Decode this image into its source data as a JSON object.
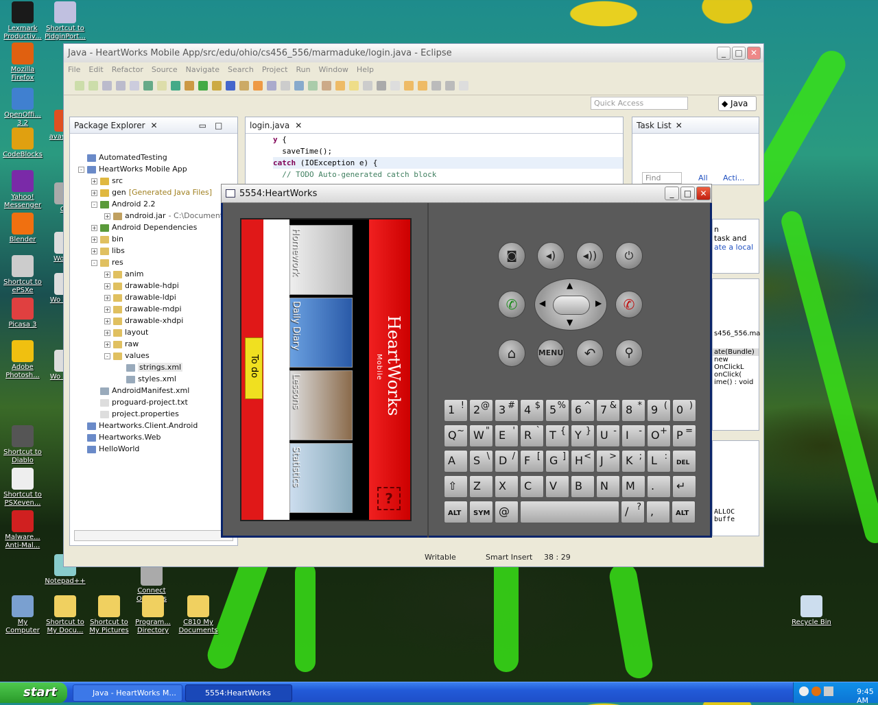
{
  "desktop": {
    "icons": [
      {
        "label": "Lexmark Productiv...",
        "color": "#1a1a1a"
      },
      {
        "label": "Shortcut to PidginPort...",
        "color": "#c0c0e0"
      },
      {
        "label": "Mozilla Firefox",
        "color": "#e06010"
      },
      {
        "label": "OpenOffi... 3.2",
        "color": "#4080d0"
      },
      {
        "label": "avas Anti",
        "color": "#e05020"
      },
      {
        "label": "CodeBlocks",
        "color": "#e0a010"
      },
      {
        "label": "Yahoo! Messenger",
        "color": "#7a2aa8"
      },
      {
        "label": "Git",
        "color": "#aaa"
      },
      {
        "label": "Blender",
        "color": "#f07010"
      },
      {
        "label": "Wo Wa",
        "color": "#ddd"
      },
      {
        "label": "Shortcut to ePSXe",
        "color": "#ccc"
      },
      {
        "label": "Wo Ward",
        "color": "#ddd"
      },
      {
        "label": "Picasa 3",
        "color": "#e04040"
      },
      {
        "label": "Adobe Photosh...",
        "color": "#f0c010"
      },
      {
        "label": "Wo Ward",
        "color": "#ddd"
      },
      {
        "label": "Shortcut to Diablo",
        "color": "#555"
      },
      {
        "label": "Shortcut to PSXeven...",
        "color": "#eee"
      },
      {
        "label": "Malware... Anti-Mal...",
        "color": "#d02020"
      },
      {
        "label": "Notepad++",
        "color": "#8cc"
      },
      {
        "label": "Connect OhioHills",
        "color": "#aaa"
      },
      {
        "label": "My Computer",
        "color": "#7aa0d0"
      },
      {
        "label": "Shortcut to My Docu...",
        "color": "#f0d060"
      },
      {
        "label": "Shortcut to My Pictures",
        "color": "#f0d060"
      },
      {
        "label": "Program... Directory",
        "color": "#f0d060"
      },
      {
        "label": "C810 My Documents",
        "color": "#f0d060"
      },
      {
        "label": "Recycle Bin",
        "color": "#cde"
      }
    ]
  },
  "eclipse": {
    "title": "Java - HeartWorks Mobile App/src/edu/ohio/cs456_556/marmaduke/login.java - Eclipse",
    "menu": [
      "File",
      "Edit",
      "Refactor",
      "Source",
      "Navigate",
      "Search",
      "Project",
      "Run",
      "Window",
      "Help"
    ],
    "quick_access": "Quick Access",
    "perspective": "Java",
    "package_explorer": {
      "tab": "Package Explorer",
      "items": [
        {
          "label": "AutomatedTesting",
          "depth": 0,
          "exp": "",
          "color": "#6a8ac8"
        },
        {
          "label": "HeartWorks Mobile App",
          "depth": 0,
          "exp": "-",
          "color": "#6a8ac8"
        },
        {
          "label": "src",
          "depth": 1,
          "exp": "+",
          "color": "#e0b840"
        },
        {
          "label": "gen",
          "depth": 1,
          "exp": "+",
          "color": "#e0b840",
          "note": "[Generated Java Files]"
        },
        {
          "label": "Android 2.2",
          "depth": 1,
          "exp": "-",
          "color": "#5a9a3a"
        },
        {
          "label": "android.jar",
          "depth": 2,
          "exp": "+",
          "color": "#c0a060",
          "note": "- C:\\Documents"
        },
        {
          "label": "Android Dependencies",
          "depth": 1,
          "exp": "+",
          "color": "#5a9a3a"
        },
        {
          "label": "bin",
          "depth": 1,
          "exp": "+",
          "color": "#e0c060"
        },
        {
          "label": "libs",
          "depth": 1,
          "exp": "+",
          "color": "#e0c060"
        },
        {
          "label": "res",
          "depth": 1,
          "exp": "-",
          "color": "#e0c060"
        },
        {
          "label": "anim",
          "depth": 2,
          "exp": "+",
          "color": "#e0c060"
        },
        {
          "label": "drawable-hdpi",
          "depth": 2,
          "exp": "+",
          "color": "#e0c060"
        },
        {
          "label": "drawable-ldpi",
          "depth": 2,
          "exp": "+",
          "color": "#e0c060"
        },
        {
          "label": "drawable-mdpi",
          "depth": 2,
          "exp": "+",
          "color": "#e0c060"
        },
        {
          "label": "drawable-xhdpi",
          "depth": 2,
          "exp": "+",
          "color": "#e0c060"
        },
        {
          "label": "layout",
          "depth": 2,
          "exp": "+",
          "color": "#e0c060"
        },
        {
          "label": "raw",
          "depth": 2,
          "exp": "+",
          "color": "#e0c060"
        },
        {
          "label": "values",
          "depth": 2,
          "exp": "-",
          "color": "#e0c060"
        },
        {
          "label": "strings.xml",
          "depth": 3,
          "exp": "",
          "color": "#9ab",
          "selected": true
        },
        {
          "label": "styles.xml",
          "depth": 3,
          "exp": "",
          "color": "#9ab"
        },
        {
          "label": "AndroidManifest.xml",
          "depth": 1,
          "exp": "",
          "color": "#9ab"
        },
        {
          "label": "proguard-project.txt",
          "depth": 1,
          "exp": "",
          "color": "#ddd"
        },
        {
          "label": "project.properties",
          "depth": 1,
          "exp": "",
          "color": "#ddd"
        },
        {
          "label": "Heartworks.Client.Android",
          "depth": 0,
          "exp": "",
          "color": "#6a8ac8"
        },
        {
          "label": "Heartworks.Web",
          "depth": 0,
          "exp": "",
          "color": "#6a8ac8"
        },
        {
          "label": "HelloWorld",
          "depth": 0,
          "exp": "",
          "color": "#6a8ac8"
        }
      ]
    },
    "editor": {
      "tab": "login.java",
      "lines": [
        {
          "kw": "y",
          "rest": " {"
        },
        {
          "kw": "",
          "rest": "  saveTime();"
        },
        {
          "kw": "catch",
          "rest": " (IOException e) {"
        },
        {
          "kw": "",
          "rest": "  // TODO Auto-generated catch block",
          "comment": true
        }
      ]
    },
    "tasklist": {
      "tab": "Task List",
      "find": "Find",
      "all": "All",
      "acti": "Acti..."
    },
    "side_fragments": [
      "n",
      "task and",
      "ate a local",
      "s456_556.ma",
      "ate(Bundle)",
      "new OnClickL",
      "onClick(",
      "ime() : void",
      "ALLOC",
      "buffe"
    ],
    "status": {
      "writable": "Writable",
      "insert": "Smart Insert",
      "position": "38 : 29"
    }
  },
  "emulator": {
    "title": "5554:HeartWorks",
    "app": {
      "brand": "HeartWorks",
      "brand_sub": "Mobile",
      "tabs": [
        "Homework",
        "Daily Diary",
        "Lessons",
        "Statistics"
      ],
      "todo": "To do"
    },
    "keys": [
      [
        "1",
        "!"
      ],
      [
        "2",
        "@"
      ],
      [
        "3",
        "#"
      ],
      [
        "4",
        "$"
      ],
      [
        "5",
        "%"
      ],
      [
        "6",
        "^"
      ],
      [
        "7",
        "&"
      ],
      [
        "8",
        "*"
      ],
      [
        "9",
        "("
      ],
      [
        "0",
        ")"
      ],
      [
        "Q",
        "~"
      ],
      [
        "W",
        "\""
      ],
      [
        "E",
        "'"
      ],
      [
        "R",
        "`"
      ],
      [
        "T",
        "{"
      ],
      [
        "Y",
        "}"
      ],
      [
        "U",
        "-"
      ],
      [
        "I",
        "-"
      ],
      [
        "O",
        "+"
      ],
      [
        "P",
        "="
      ],
      [
        "A",
        ""
      ],
      [
        "S",
        "\\"
      ],
      [
        "D",
        "/"
      ],
      [
        "F",
        "["
      ],
      [
        "G",
        "]"
      ],
      [
        "H",
        "<"
      ],
      [
        "J",
        ">"
      ],
      [
        "K",
        ";"
      ],
      [
        "L",
        ":"
      ],
      [
        "DEL",
        ""
      ],
      [
        "⇧",
        ""
      ],
      [
        "Z",
        ""
      ],
      [
        "X",
        ""
      ],
      [
        "C",
        ""
      ],
      [
        "V",
        ""
      ],
      [
        "B",
        ""
      ],
      [
        "N",
        ""
      ],
      [
        "M",
        ""
      ],
      [
        ".",
        ""
      ],
      [
        "↵",
        ""
      ]
    ],
    "bottom_keys": [
      "ALT",
      "SYM",
      "@",
      "",
      "/",
      "?",
      ",",
      "ALT"
    ],
    "menu_label": "MENU"
  },
  "taskbar": {
    "start": "start",
    "tasks": [
      "Java - HeartWorks M...",
      "5554:HeartWorks"
    ],
    "clock": "9:45 AM"
  }
}
